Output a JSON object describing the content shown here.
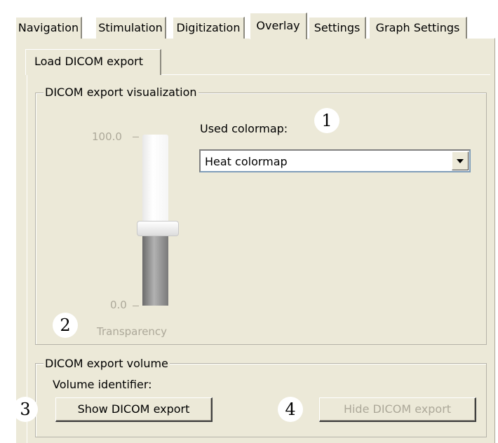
{
  "tabs": [
    "Navigation",
    "Stimulation",
    "Digitization",
    "Overlay",
    "Settings",
    "Graph Settings"
  ],
  "active_tab": "Overlay",
  "subtab": "Load DICOM export",
  "visualization_group": {
    "title": "DICOM export visualization",
    "colormap_label": "Used colormap:",
    "colormap_value": "Heat colormap",
    "slider": {
      "max_label": "100.0",
      "min_label": "0.0",
      "caption": "Transparency",
      "level_fraction": 0.45
    }
  },
  "volume_group": {
    "title": "DICOM export volume",
    "identifier_label": "Volume identifier:",
    "show_button": "Show DICOM export",
    "hide_button": "Hide DICOM export"
  },
  "markers": [
    "1",
    "2",
    "3",
    "4"
  ],
  "colors": {
    "panel_bg": "#ece9d8",
    "disabled_text": "#aca899",
    "select_border": "#7f9db9"
  },
  "icons": [
    "dropdown-arrow-icon"
  ]
}
